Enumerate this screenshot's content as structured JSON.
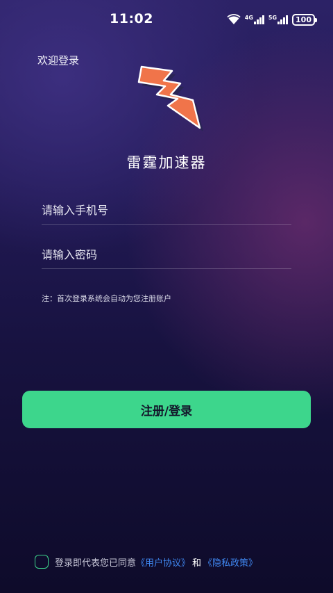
{
  "status_bar": {
    "time": "11:02",
    "network_1": "4G",
    "network_2": "5G",
    "battery": "100"
  },
  "header": {
    "welcome": "欢迎登录",
    "app_name": "雷霆加速器"
  },
  "form": {
    "phone_placeholder": "请输入手机号",
    "password_placeholder": "请输入密码",
    "note": "注：首次登录系统会自动为您注册账户",
    "submit_label": "注册/登录"
  },
  "agreement": {
    "prefix": "登录即代表您已同意",
    "user_agreement": "《用户协议》",
    "conjunction": "和",
    "privacy_policy": "《隐私政策》"
  },
  "icons": {
    "logo": "lightning-bolt-icon",
    "wifi": "wifi-icon",
    "checkbox": "checkbox-unchecked"
  },
  "colors": {
    "accent": "#3dd68c",
    "link": "#3f86ee",
    "logo": "#f0744a"
  }
}
